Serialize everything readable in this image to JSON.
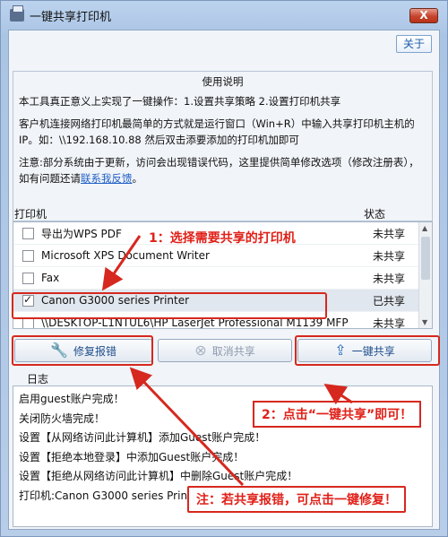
{
  "window": {
    "title": "一键共享打印机",
    "close_label": "X",
    "about_label": "关于"
  },
  "instructions": {
    "title": "使用说明",
    "p1": "本工具真正意义上实现了一键操作：1.设置共享策略 2.设置打印机共享",
    "p2": "客户机连接网络打印机最简单的方式就是运行窗口（Win+R）中输入共享打印机主机的IP。如：\\\\192.168.10.88 然后双击添要添加的打印机加即可",
    "p3_prefix": "注意:部分系统由于更新，访问会出现错误代码，这里提供简单修改选项（修改注册表），如有问题还请",
    "p3_link": "联系我反馈",
    "p3_suffix": "。"
  },
  "printer_list": {
    "col_printer": "打印机",
    "col_status": "状态",
    "rows": [
      {
        "name": "导出为WPS PDF",
        "status": "未共享",
        "checked": false
      },
      {
        "name": "Microsoft XPS Document Writer",
        "status": "未共享",
        "checked": false
      },
      {
        "name": "Fax",
        "status": "未共享",
        "checked": false
      },
      {
        "name": "Canon G3000 series Printer",
        "status": "已共享",
        "checked": true
      },
      {
        "name": "\\\\DESKTOP-L1NTUL6\\HP LaserJet Professional M1139 MFP",
        "status": "未共享",
        "checked": false
      }
    ]
  },
  "buttons": {
    "repair": "修复报错",
    "cancel_share": "取消共享",
    "one_key_share": "一键共享"
  },
  "log": {
    "label": "日志",
    "lines": [
      "启用guest账户完成！",
      "关闭防火墙完成！",
      "设置【从网络访问此计算机】添加Guest账户完成！",
      "设置【拒绝本地登录】中添加Guest账户完成！",
      "设置【拒绝从网络访问此计算机】中删除Guest账户完成！",
      "打印机:Canon G3000 series Printer共享成功！"
    ]
  },
  "annotations": {
    "step1": "1：选择需要共享的打印机",
    "step2": "2：点击“一键共享”即可！",
    "note": "注：若共享报错，可点击一键修复！"
  },
  "colors": {
    "annotation_red": "#d6281e",
    "link_blue": "#1f5fc6"
  }
}
